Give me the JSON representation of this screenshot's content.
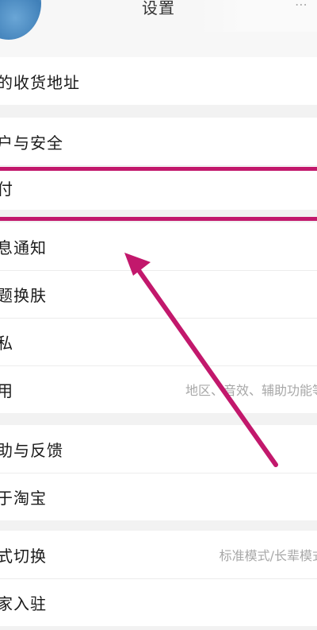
{
  "header": {
    "title": "设置"
  },
  "groups": [
    {
      "items": [
        {
          "label": "的收货地址"
        }
      ]
    },
    {
      "items": [
        {
          "label": "户与安全"
        },
        {
          "label": "付"
        }
      ]
    },
    {
      "items": [
        {
          "label": "息通知"
        },
        {
          "label": "题换肤"
        },
        {
          "label": "私"
        },
        {
          "label": "用",
          "hint": "地区、音效、辅助功能等"
        }
      ]
    },
    {
      "items": [
        {
          "label": "助与反馈"
        },
        {
          "label": "于淘宝"
        }
      ]
    },
    {
      "items": [
        {
          "label": "式切换",
          "hint": "标准模式/长辈模式"
        },
        {
          "label": "家入驻"
        }
      ]
    }
  ],
  "annotation": {
    "color": "#c2186c"
  }
}
